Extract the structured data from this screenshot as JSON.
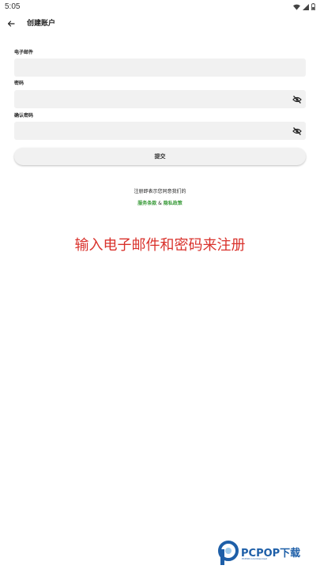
{
  "status_bar": {
    "time": "5:05"
  },
  "header": {
    "title": "创建账户"
  },
  "form": {
    "email_label": "电子邮件",
    "email_value": "",
    "password_label": "密码",
    "password_value": "",
    "confirm_label": "确认密码",
    "confirm_value": "",
    "submit_label": "提交"
  },
  "terms": {
    "prefix": "注册即表示您同意我们的",
    "service_link": "服务条款",
    "separator": " & ",
    "privacy_link": "隐私政策"
  },
  "caption": "输入电子邮件和密码来注册",
  "watermark": {
    "brand": "PCPOP下载",
    "tagline": "PCPOP.com/download"
  },
  "colors": {
    "link": "#3a9b3a",
    "caption": "#d9312b",
    "field_bg": "#f1f1f1",
    "watermark": "#1e5fa8"
  }
}
